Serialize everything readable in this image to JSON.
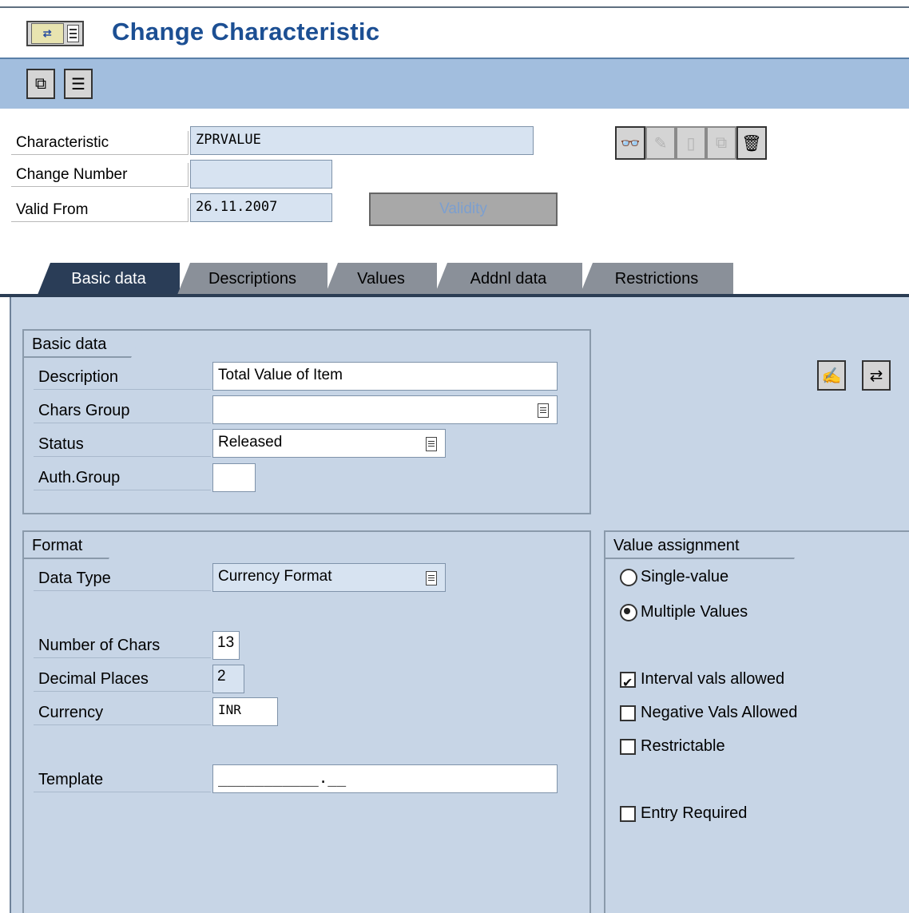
{
  "title_bar": {
    "menu_icon": "sap-menu-icon",
    "title": "Change Characteristic"
  },
  "toolbar": {
    "buttons": [
      {
        "name": "other-characteristic-icon"
      },
      {
        "name": "classification-icon"
      }
    ]
  },
  "header": {
    "characteristic_label": "Characteristic",
    "characteristic_value": "ZPRVALUE",
    "change_number_label": "Change Number",
    "change_number_value": "",
    "valid_from_label": "Valid From",
    "valid_from_value": "26.11.2007",
    "validity_button": "Validity",
    "icons": [
      "display-icon",
      "change-icon",
      "create-icon",
      "copy-icon",
      "delete-icon"
    ]
  },
  "tabs": [
    {
      "label": "Basic data",
      "active": true
    },
    {
      "label": "Descriptions",
      "active": false
    },
    {
      "label": "Values",
      "active": false
    },
    {
      "label": "Addnl data",
      "active": false
    },
    {
      "label": "Restrictions",
      "active": false
    }
  ],
  "basic_data": {
    "group_title": "Basic data",
    "description_label": "Description",
    "description_value": "Total Value of Item",
    "chars_group_label": "Chars Group",
    "chars_group_value": "",
    "status_label": "Status",
    "status_value": "Released",
    "auth_group_label": "Auth.Group",
    "auth_group_value": ""
  },
  "side_icons": [
    "edit-text-icon",
    "switch-icon"
  ],
  "format": {
    "group_title": "Format",
    "data_type_label": "Data Type",
    "data_type_value": "Currency Format",
    "num_chars_label": "Number of Chars",
    "num_chars_value": "13",
    "decimal_places_label": "Decimal Places",
    "decimal_places_value": "2",
    "currency_label": "Currency",
    "currency_value": "INR",
    "template_label": "Template",
    "template_value": "___________.__"
  },
  "value_assignment": {
    "group_title": "Value assignment",
    "single_value_label": "Single-value",
    "single_value_selected": false,
    "multiple_values_label": "Multiple Values",
    "multiple_values_selected": true,
    "interval_label": "Interval vals allowed",
    "interval_checked": true,
    "negative_label": "Negative Vals Allowed",
    "negative_checked": false,
    "restrictable_label": "Restrictable",
    "restrictable_checked": false,
    "entry_required_label": "Entry Required",
    "entry_required_checked": false
  }
}
